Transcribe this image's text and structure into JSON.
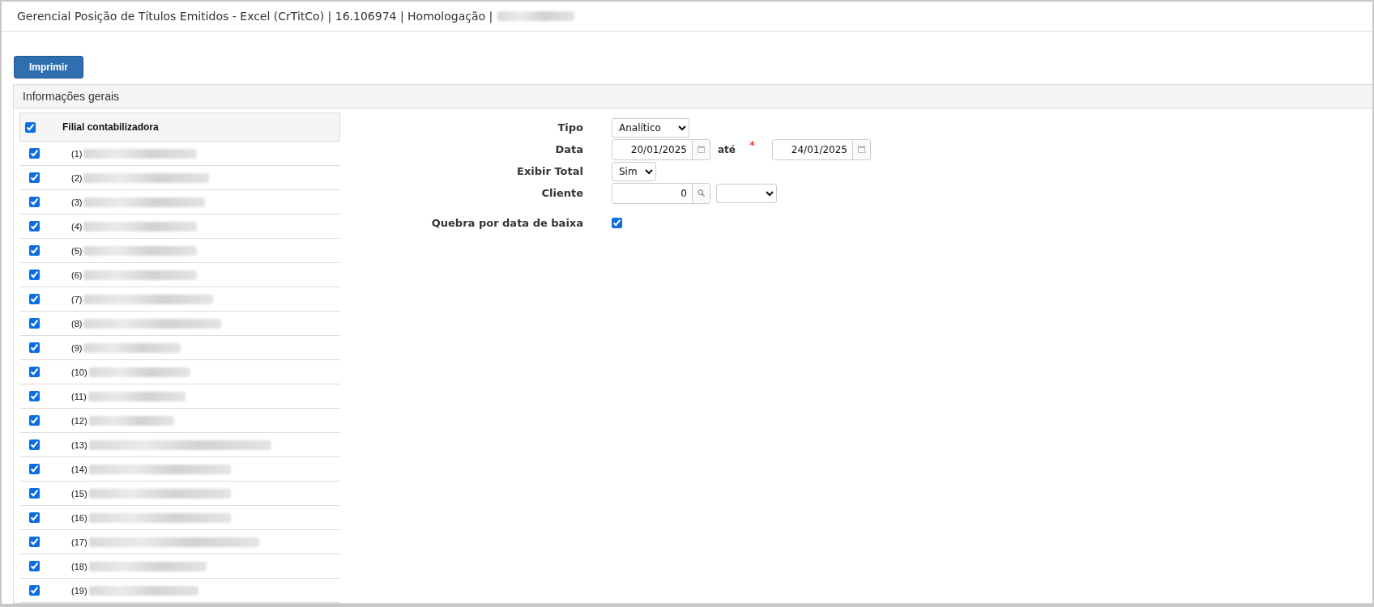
{
  "window": {
    "title": "Gerencial Posição de Títulos Emitidos - Excel (CrTitCo) | 16.106974 | Homologação |"
  },
  "toolbar": {
    "print_button": "Imprimir"
  },
  "panel": {
    "title": "Informações gerais"
  },
  "branches": {
    "header": "Filial contabilizadora",
    "all_checked": true,
    "rows": [
      {
        "number": "(1)",
        "checked": true
      },
      {
        "number": "(2)",
        "checked": true
      },
      {
        "number": "(3)",
        "checked": true
      },
      {
        "number": "(4)",
        "checked": true
      },
      {
        "number": "(5)",
        "checked": true
      },
      {
        "number": "(6)",
        "checked": true
      },
      {
        "number": "(7)",
        "checked": true
      },
      {
        "number": "(8)",
        "checked": true
      },
      {
        "number": "(9)",
        "checked": true
      },
      {
        "number": "(10)",
        "checked": true
      },
      {
        "number": "(11)",
        "checked": true
      },
      {
        "number": "(12)",
        "checked": true
      },
      {
        "number": "(13)",
        "checked": true
      },
      {
        "number": "(14)",
        "checked": true
      },
      {
        "number": "(15)",
        "checked": true
      },
      {
        "number": "(16)",
        "checked": true
      },
      {
        "number": "(17)",
        "checked": true
      },
      {
        "number": "(18)",
        "checked": true
      },
      {
        "number": "(19)",
        "checked": true
      }
    ]
  },
  "form": {
    "tipo": {
      "label": "Tipo",
      "value": "Analítico"
    },
    "data": {
      "label": "Data",
      "from": "20/01/2025",
      "separator": "até",
      "required_mark": "*",
      "to": "24/01/2025"
    },
    "exibir_total": {
      "label": "Exibir Total",
      "value": "Sim"
    },
    "cliente": {
      "label": "Cliente",
      "value": "0"
    },
    "quebra": {
      "label": "Quebra por data de baixa",
      "checked": true
    }
  }
}
